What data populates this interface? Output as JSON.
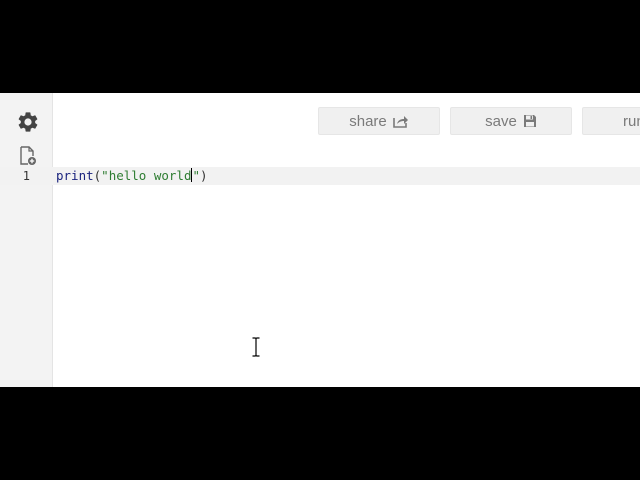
{
  "toolbar": {
    "share_label": "share",
    "save_label": "save",
    "run_label": "run"
  },
  "editor": {
    "line_numbers": [
      "1"
    ],
    "code": {
      "fn": "print",
      "open_paren": "(",
      "string_before_caret": "\"hello world",
      "string_after_caret": "\"",
      "close_paren": ")"
    }
  },
  "icons": {
    "settings": "gear-icon",
    "new_file": "new-file-icon",
    "share": "share-icon",
    "save": "floppy-disk-icon",
    "cursor": "text-cursor-icon"
  },
  "colors": {
    "gutter_bg": "#f3f3f3",
    "active_line_bg": "#f2f2f2",
    "button_bg": "#f0f0f0",
    "button_text": "#7a7a7a",
    "function_token": "#1a237e",
    "string_token": "#2e7d32"
  }
}
